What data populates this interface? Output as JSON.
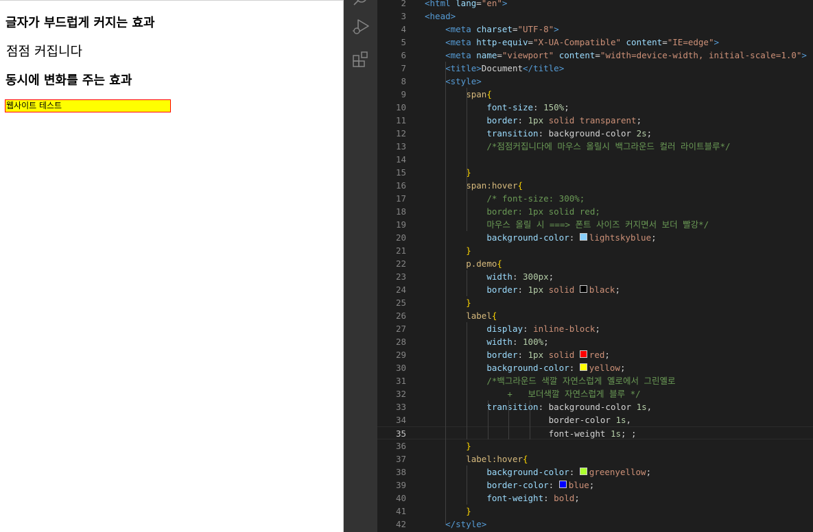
{
  "browser": {
    "heading1": "글자가 부드럽게 커지는 효과",
    "grow_text": "점점 커집니다",
    "heading2": "동시에 변화를 주는 효과",
    "label_text": "웹사이트 테스트"
  },
  "activity_bar": {
    "icons": [
      "search-icon",
      "run-debug-icon",
      "extensions-icon"
    ]
  },
  "editor": {
    "current_line": 35,
    "lines": [
      {
        "n": "2",
        "t": [
          [
            "tag",
            "<html "
          ],
          [
            "attr",
            "lang"
          ],
          [
            "",
            "="
          ],
          [
            "str",
            "\"en\""
          ],
          [
            "tag",
            ">"
          ]
        ]
      },
      {
        "n": "3",
        "t": [
          [
            "tag",
            "<head>"
          ]
        ]
      },
      {
        "n": "4",
        "t": [
          [
            "",
            "    "
          ],
          [
            "tag",
            "<meta "
          ],
          [
            "attr",
            "charset"
          ],
          [
            "",
            "="
          ],
          [
            "str",
            "\"UTF-8\""
          ],
          [
            "tag",
            ">"
          ]
        ]
      },
      {
        "n": "5",
        "t": [
          [
            "",
            "    "
          ],
          [
            "tag",
            "<meta "
          ],
          [
            "attr",
            "http-equiv"
          ],
          [
            "",
            "="
          ],
          [
            "str",
            "\"X-UA-Compatible\""
          ],
          [
            "",
            " "
          ],
          [
            "attr",
            "content"
          ],
          [
            "",
            "="
          ],
          [
            "str",
            "\"IE=edge\""
          ],
          [
            "tag",
            ">"
          ]
        ]
      },
      {
        "n": "6",
        "t": [
          [
            "",
            "    "
          ],
          [
            "tag",
            "<meta "
          ],
          [
            "attr",
            "name"
          ],
          [
            "",
            "="
          ],
          [
            "str",
            "\"viewport\""
          ],
          [
            "",
            " "
          ],
          [
            "attr",
            "content"
          ],
          [
            "",
            "="
          ],
          [
            "str",
            "\"width=device-width, initial-scale=1.0\""
          ],
          [
            "tag",
            ">"
          ]
        ]
      },
      {
        "n": "7",
        "t": [
          [
            "",
            "    "
          ],
          [
            "tag",
            "<title>"
          ],
          [
            "",
            "Document"
          ],
          [
            "tag",
            "</title>"
          ]
        ]
      },
      {
        "n": "8",
        "t": [
          [
            "",
            "    "
          ],
          [
            "tag",
            "<style>"
          ]
        ]
      },
      {
        "n": "9",
        "t": [
          [
            "",
            "        "
          ],
          [
            "sel",
            "span"
          ],
          [
            "br",
            "{"
          ]
        ]
      },
      {
        "n": "10",
        "t": [
          [
            "",
            "            "
          ],
          [
            "prop",
            "font-size"
          ],
          [
            "",
            ": "
          ],
          [
            "num",
            "150%"
          ],
          [
            "",
            ";"
          ]
        ]
      },
      {
        "n": "11",
        "t": [
          [
            "",
            "            "
          ],
          [
            "prop",
            "border"
          ],
          [
            "",
            ": "
          ],
          [
            "num",
            "1px"
          ],
          [
            "",
            " "
          ],
          [
            "val",
            "solid transparent"
          ],
          [
            "",
            ";"
          ]
        ]
      },
      {
        "n": "12",
        "t": [
          [
            "",
            "            "
          ],
          [
            "prop",
            "transition"
          ],
          [
            "",
            ": "
          ],
          [
            "",
            "background-color "
          ],
          [
            "num",
            "2s"
          ],
          [
            "",
            ";"
          ]
        ]
      },
      {
        "n": "13",
        "t": [
          [
            "",
            "            "
          ],
          [
            "cm",
            "/*점점커집니다에 마우스 올릴시 백그라운드 컬러 라이트블루*/"
          ]
        ]
      },
      {
        "n": "14",
        "t": []
      },
      {
        "n": "15",
        "t": [
          [
            "",
            "        "
          ],
          [
            "br",
            "}"
          ]
        ]
      },
      {
        "n": "16",
        "t": [
          [
            "",
            "        "
          ],
          [
            "sel",
            "span:hover"
          ],
          [
            "br",
            "{"
          ]
        ]
      },
      {
        "n": "17",
        "t": [
          [
            "",
            "            "
          ],
          [
            "cm",
            "/* font-size: 300%;"
          ]
        ]
      },
      {
        "n": "18",
        "t": [
          [
            "",
            "            "
          ],
          [
            "cm",
            "border: 1px solid red;"
          ]
        ]
      },
      {
        "n": "19",
        "t": [
          [
            "",
            "            "
          ],
          [
            "cm",
            "마우스 올릴 시 ===> 폰트 사이즈 커지면서 보더 빨강*/"
          ]
        ]
      },
      {
        "n": "20",
        "t": [
          [
            "",
            "            "
          ],
          [
            "prop",
            "background-color"
          ],
          [
            "",
            ": "
          ],
          [
            "sw",
            "#87cefa"
          ],
          [
            "val",
            "lightskyblue"
          ],
          [
            "",
            ";"
          ]
        ]
      },
      {
        "n": "21",
        "t": [
          [
            "",
            "        "
          ],
          [
            "br",
            "}"
          ]
        ]
      },
      {
        "n": "22",
        "t": [
          [
            "",
            "        "
          ],
          [
            "sel",
            "p.demo"
          ],
          [
            "br",
            "{"
          ]
        ]
      },
      {
        "n": "23",
        "t": [
          [
            "",
            "            "
          ],
          [
            "prop",
            "width"
          ],
          [
            "",
            ": "
          ],
          [
            "num",
            "300px"
          ],
          [
            "",
            ";"
          ]
        ]
      },
      {
        "n": "24",
        "t": [
          [
            "",
            "            "
          ],
          [
            "prop",
            "border"
          ],
          [
            "",
            ": "
          ],
          [
            "num",
            "1px"
          ],
          [
            "",
            " "
          ],
          [
            "val",
            "solid "
          ],
          [
            "sw",
            "#000000"
          ],
          [
            "val",
            "black"
          ],
          [
            "",
            ";"
          ]
        ]
      },
      {
        "n": "25",
        "t": [
          [
            "",
            "        "
          ],
          [
            "br",
            "}"
          ]
        ]
      },
      {
        "n": "26",
        "t": [
          [
            "",
            "        "
          ],
          [
            "sel",
            "label"
          ],
          [
            "br",
            "{"
          ]
        ]
      },
      {
        "n": "27",
        "t": [
          [
            "",
            "            "
          ],
          [
            "prop",
            "display"
          ],
          [
            "",
            ": "
          ],
          [
            "val",
            "inline-block"
          ],
          [
            "",
            ";"
          ]
        ]
      },
      {
        "n": "28",
        "t": [
          [
            "",
            "            "
          ],
          [
            "prop",
            "width"
          ],
          [
            "",
            ": "
          ],
          [
            "num",
            "100%"
          ],
          [
            "",
            ";"
          ]
        ]
      },
      {
        "n": "29",
        "t": [
          [
            "",
            "            "
          ],
          [
            "prop",
            "border"
          ],
          [
            "",
            ": "
          ],
          [
            "num",
            "1px"
          ],
          [
            "",
            " "
          ],
          [
            "val",
            "solid "
          ],
          [
            "sw",
            "#ff0000"
          ],
          [
            "val",
            "red"
          ],
          [
            "",
            ";"
          ]
        ]
      },
      {
        "n": "30",
        "t": [
          [
            "",
            "            "
          ],
          [
            "prop",
            "background-color"
          ],
          [
            "",
            ": "
          ],
          [
            "sw",
            "#ffff00"
          ],
          [
            "val",
            "yellow"
          ],
          [
            "",
            ";"
          ]
        ]
      },
      {
        "n": "31",
        "t": [
          [
            "",
            "            "
          ],
          [
            "cm",
            "/*백그라운드 색깔 자연스럽게 옐로에서 그린옐로"
          ]
        ]
      },
      {
        "n": "32",
        "t": [
          [
            "",
            "                "
          ],
          [
            "cm",
            "+   보더색깔 자연스럽게 블루 */"
          ]
        ]
      },
      {
        "n": "33",
        "t": [
          [
            "",
            "            "
          ],
          [
            "prop",
            "transition"
          ],
          [
            "",
            ": "
          ],
          [
            "",
            "background-color "
          ],
          [
            "num",
            "1s"
          ],
          [
            "",
            ","
          ]
        ]
      },
      {
        "n": "34",
        "t": [
          [
            "",
            "                        "
          ],
          [
            "",
            "border-color "
          ],
          [
            "num",
            "1s"
          ],
          [
            "",
            ","
          ]
        ]
      },
      {
        "n": "35",
        "t": [
          [
            "",
            "                        "
          ],
          [
            "",
            "font-weight "
          ],
          [
            "num",
            "1s"
          ],
          [
            "",
            "; ;"
          ]
        ]
      },
      {
        "n": "36",
        "t": [
          [
            "",
            "        "
          ],
          [
            "br",
            "}"
          ]
        ]
      },
      {
        "n": "37",
        "t": [
          [
            "",
            "        "
          ],
          [
            "sel",
            "label:hover"
          ],
          [
            "br",
            "{"
          ]
        ]
      },
      {
        "n": "38",
        "t": [
          [
            "",
            "            "
          ],
          [
            "prop",
            "background-color"
          ],
          [
            "",
            ": "
          ],
          [
            "sw",
            "#adff2f"
          ],
          [
            "val",
            "greenyellow"
          ],
          [
            "",
            ";"
          ]
        ]
      },
      {
        "n": "39",
        "t": [
          [
            "",
            "            "
          ],
          [
            "prop",
            "border-color"
          ],
          [
            "",
            ": "
          ],
          [
            "sw",
            "#0000ff"
          ],
          [
            "val",
            "blue"
          ],
          [
            "",
            ";"
          ]
        ]
      },
      {
        "n": "40",
        "t": [
          [
            "",
            "            "
          ],
          [
            "prop",
            "font-weight"
          ],
          [
            "",
            ": "
          ],
          [
            "val",
            "bold"
          ],
          [
            "",
            ";"
          ]
        ]
      },
      {
        "n": "41",
        "t": [
          [
            "",
            "        "
          ],
          [
            "br",
            "}"
          ]
        ]
      },
      {
        "n": "42",
        "t": [
          [
            "",
            "    "
          ],
          [
            "tag",
            "</style>"
          ]
        ]
      }
    ]
  }
}
